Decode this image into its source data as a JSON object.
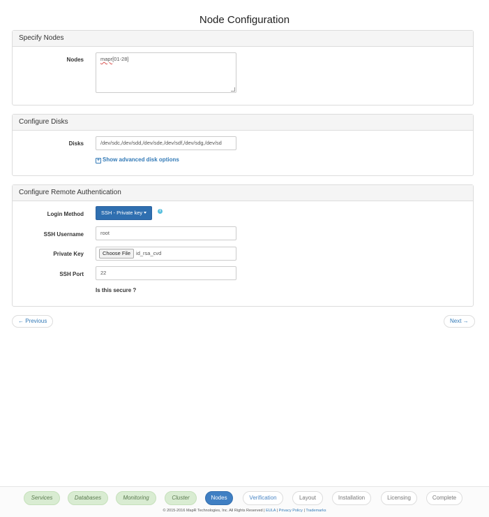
{
  "page": {
    "title": "Node Configuration"
  },
  "specify_nodes": {
    "heading": "Specify Nodes",
    "nodes_label": "Nodes",
    "nodes_value_prefix": "mapr",
    "nodes_value_suffix": "[01-28]"
  },
  "configure_disks": {
    "heading": "Configure Disks",
    "disks_label": "Disks",
    "disks_value": "/dev/sdc,/dev/sdd,/dev/sde,/dev/sdf,/dev/sdg,/dev/sd",
    "advanced_link": "Show advanced disk options"
  },
  "remote_auth": {
    "heading": "Configure Remote Authentication",
    "login_method_label": "Login Method",
    "login_method_value": "SSH - Private key",
    "ssh_username_label": "SSH Username",
    "ssh_username_value": "root",
    "private_key_label": "Private Key",
    "choose_file_label": "Choose File",
    "private_key_file": "id_rsa_cvd",
    "ssh_port_label": "SSH Port",
    "ssh_port_value": "22",
    "secure_note": "Is this secure ?"
  },
  "nav": {
    "previous": "← Previous",
    "next": "Next →"
  },
  "steps": [
    {
      "label": "Services",
      "state": "done"
    },
    {
      "label": "Databases",
      "state": "done"
    },
    {
      "label": "Monitoring",
      "state": "done"
    },
    {
      "label": "Cluster",
      "state": "done"
    },
    {
      "label": "Nodes",
      "state": "active"
    },
    {
      "label": "Verification",
      "state": "next"
    },
    {
      "label": "Layout",
      "state": "pending"
    },
    {
      "label": "Installation",
      "state": "pending"
    },
    {
      "label": "Licensing",
      "state": "pending"
    },
    {
      "label": "Complete",
      "state": "pending"
    }
  ],
  "footer": {
    "copyright": "© 2015-2016 MapR Technologies, Inc. All Rights Reserved |",
    "eula": "EULA",
    "sep1": "|",
    "privacy": "Privacy Policy",
    "sep2": "|",
    "trademarks": "Trademarks"
  },
  "colors": {
    "primary": "#2f6fb0",
    "done_step": "#d9ecd2",
    "link": "#337ab7"
  },
  "icons": {
    "info": "info-icon",
    "expand": "plus-square-icon",
    "dropdown": "caret-down-icon"
  }
}
